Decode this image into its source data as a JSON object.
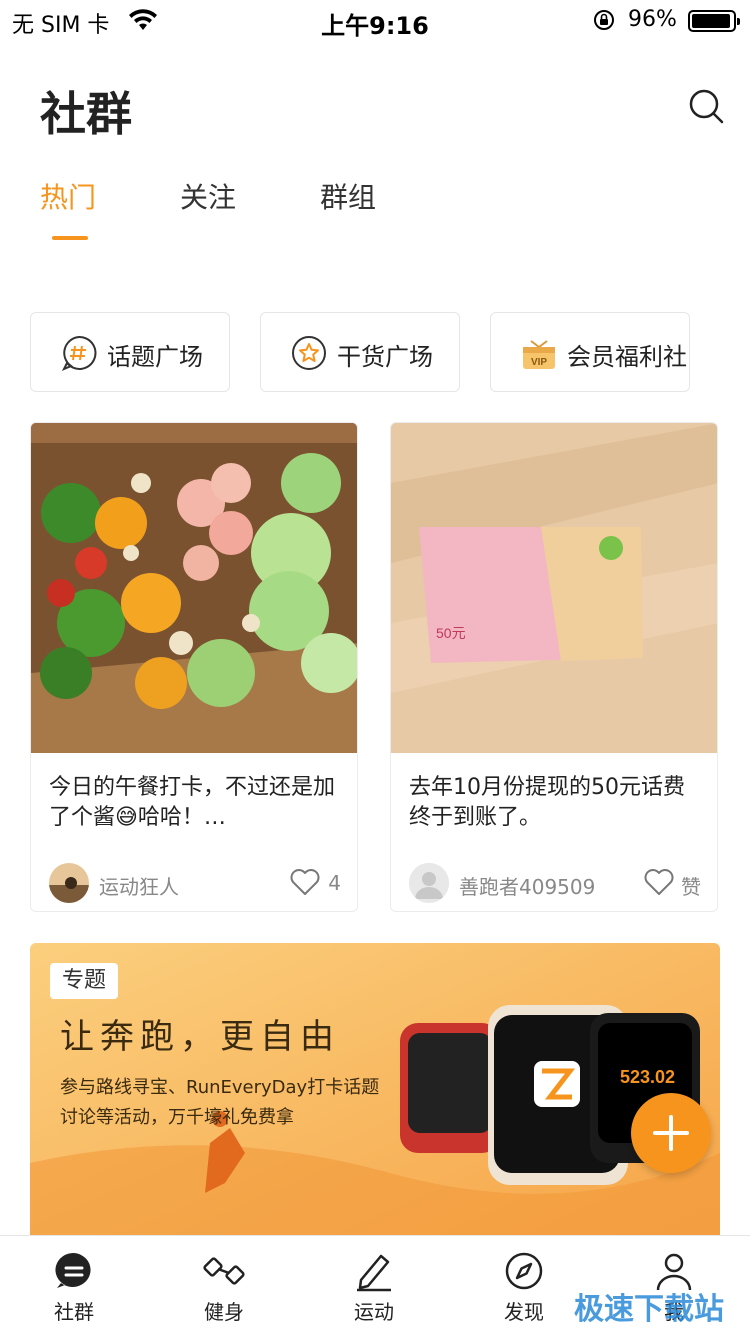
{
  "status_bar": {
    "carrier": "无 SIM 卡",
    "time": "上午9:16",
    "battery_percent": "96%",
    "battery_level": 0.96
  },
  "header": {
    "title": "社群",
    "search_icon": "search-icon"
  },
  "tabs": [
    {
      "label": "热门",
      "active": true
    },
    {
      "label": "关注",
      "active": false
    },
    {
      "label": "群组",
      "active": false
    }
  ],
  "quick_links": [
    {
      "label": "话题广场",
      "icon": "hashtag-bubble-icon"
    },
    {
      "label": "干货广场",
      "icon": "star-circle-icon"
    },
    {
      "label": "会员福利社",
      "icon": "vip-gift-icon"
    }
  ],
  "posts": [
    {
      "caption": "今日的午餐打卡，不过还是加了个酱😅哈哈！…",
      "author": "运动狂人",
      "likes": "4",
      "image": "salad-photo"
    },
    {
      "caption": "去年10月份提现的50元话费终于到账了。",
      "author": "善跑者409509",
      "likes": "赞",
      "image": "gift-card-photo"
    }
  ],
  "banner": {
    "tag": "专题",
    "headline": "让奔跑，更自由",
    "description": "参与路线寻宝、RunEveryDay打卡话题讨论等活动，万千壕礼免费拿",
    "accent": "#f7a94a"
  },
  "fab": {
    "icon": "plus-icon",
    "color": "#f7941d"
  },
  "tabbar": [
    {
      "label": "社群",
      "icon": "chat-bubble-icon",
      "active": true
    },
    {
      "label": "健身",
      "icon": "dumbbell-icon",
      "active": false
    },
    {
      "label": "运动",
      "icon": "pen-icon",
      "active": false
    },
    {
      "label": "发现",
      "icon": "compass-icon",
      "active": false
    },
    {
      "label": "我",
      "icon": "user-icon",
      "active": false,
      "badge": true
    }
  ],
  "watermark": "极速下载站",
  "colors": {
    "accent": "#f7941d",
    "badge": "#f5222d"
  }
}
